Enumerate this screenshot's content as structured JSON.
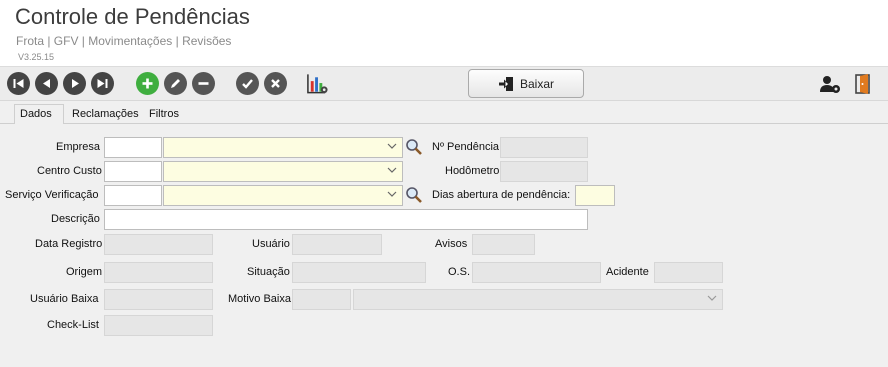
{
  "header": {
    "title": "Controle de Pendências",
    "breadcrumb": "Frota | GFV | Movimentações | Revisões",
    "version": "V3.25.15"
  },
  "toolbar": {
    "baixar_label": "Baixar",
    "icons": [
      "first-icon",
      "previous-icon",
      "play-icon",
      "last-icon",
      "add-icon",
      "edit-icon",
      "remove-icon",
      "confirm-icon",
      "cancel-icon",
      "chart-settings-icon",
      "user-settings-icon",
      "exit-door-icon"
    ]
  },
  "tabs": [
    {
      "label": "Dados",
      "active": true
    },
    {
      "label": "Reclamações",
      "active": false
    },
    {
      "label": "Filtros",
      "active": false
    }
  ],
  "form": {
    "empresa": "Empresa",
    "n_pendencia": "Nº Pendência",
    "centro_custo": "Centro Custo",
    "hodometro": "Hodômetro",
    "servico_verificacao": "Serviço Verificação",
    "dias_abertura": "Dias abertura de pendência:",
    "descricao": "Descrição",
    "data_registro": "Data Registro",
    "usuario": "Usuário",
    "avisos": "Avisos",
    "origem": "Origem",
    "situacao": "Situação",
    "os": "O.S.",
    "acidente": "Acidente",
    "usuario_baixa": "Usuário Baixa",
    "motivo_baixa": "Motivo Baixa",
    "check_list": "Check-List"
  },
  "colors": {
    "accent_green": "#3fae3f",
    "nav_dark": "#444444",
    "required_yellow": "#fdfde1"
  }
}
